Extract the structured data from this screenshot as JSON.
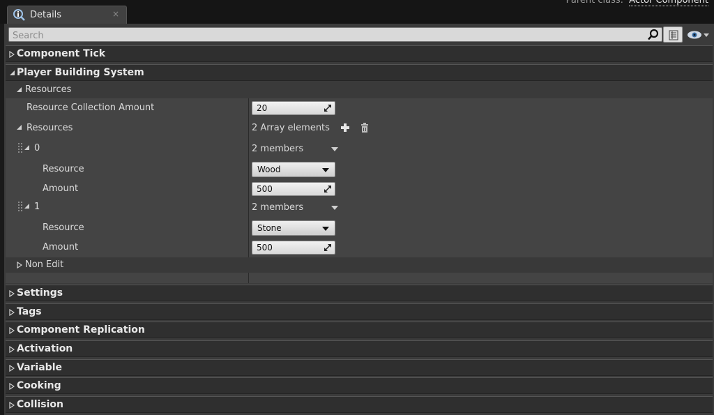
{
  "header": {
    "parent_class_label": "Parent class:",
    "parent_class_value": "Actor Component"
  },
  "tab": {
    "label": "Details",
    "close": "×"
  },
  "search": {
    "placeholder": "Search",
    "value": ""
  },
  "categories_top": [
    {
      "label": "Component Tick",
      "expanded": false
    },
    {
      "label": "Player Building System",
      "expanded": true
    }
  ],
  "player_building_system": {
    "subcategory": "Resources",
    "resource_collection_label": "Resource Collection Amount",
    "resource_collection_value": "20",
    "resources_label": "Resources",
    "resources_count_text": "2 Array elements",
    "elements": [
      {
        "index": "0",
        "members_text": "2 members",
        "resource_label": "Resource",
        "resource_value": "Wood",
        "amount_label": "Amount",
        "amount_value": "500"
      },
      {
        "index": "1",
        "members_text": "2 members",
        "resource_label": "Resource",
        "resource_value": "Stone",
        "amount_label": "Amount",
        "amount_value": "500"
      }
    ],
    "non_edit_label": "Non Edit"
  },
  "categories_bottom": [
    {
      "label": "Settings"
    },
    {
      "label": "Tags"
    },
    {
      "label": "Component Replication"
    },
    {
      "label": "Activation"
    },
    {
      "label": "Variable"
    },
    {
      "label": "Cooking"
    },
    {
      "label": "Collision"
    }
  ],
  "colors": {
    "panel_bg": "#3b3b3b",
    "category_bg": "#2f2f2f",
    "property_bg": "#444444",
    "field_bg": "#e6e6e6"
  },
  "icons": {
    "tab": "details-info-icon",
    "search": "search-icon",
    "view": "property-matrix-icon",
    "eye": "view-options-eye-icon",
    "add": "add-element-icon",
    "delete": "delete-all-icon"
  }
}
